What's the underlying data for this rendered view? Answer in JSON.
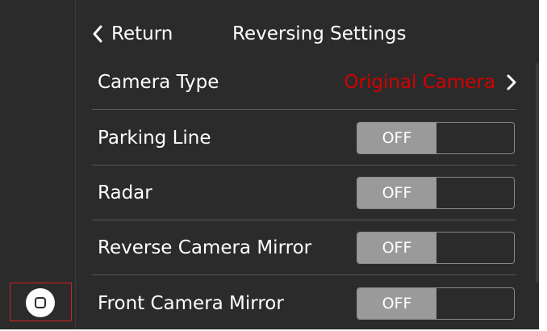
{
  "header": {
    "back_label": "Return",
    "title": "Reversing Settings"
  },
  "settings": [
    {
      "label": "Camera Type",
      "value": "Original Camera",
      "value_color": "#d40000",
      "control": "link"
    },
    {
      "label": "Parking Line",
      "toggle_state": "OFF",
      "control": "toggle"
    },
    {
      "label": "Radar",
      "toggle_state": "OFF",
      "control": "toggle"
    },
    {
      "label": "Reverse Camera Mirror",
      "toggle_state": "OFF",
      "control": "toggle"
    },
    {
      "label": "Front Camera Mirror",
      "toggle_state": "OFF",
      "control": "toggle"
    }
  ],
  "side": {
    "home_icon": "home-square-icon"
  },
  "colors": {
    "background": "#2b2b2b",
    "accent_red": "#d40000",
    "toggle_off_fill": "#9a9a9a",
    "divider": "#5a5a5a"
  }
}
